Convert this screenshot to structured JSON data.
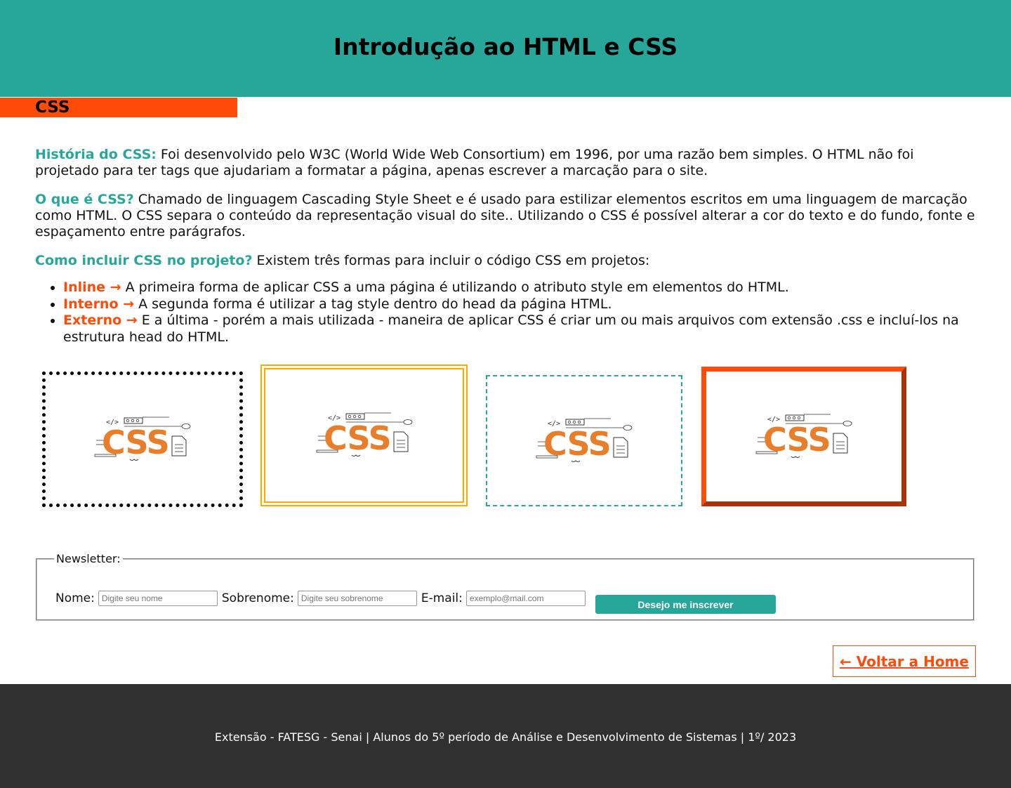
{
  "header": {
    "title": "Introdução ao HTML e CSS"
  },
  "section_tab": {
    "label": "CSS"
  },
  "content": {
    "historia": {
      "heading": "História do CSS:",
      "text": " Foi desenvolvido pelo W3C (World Wide Web Consortium) em 1996, por uma razão bem simples. O HTML não foi projetado para ter tags que ajudariam a formatar a página, apenas escrever a marcação para o site."
    },
    "oque": {
      "heading": "O que é CSS?",
      "text": " Chamado de linguagem Cascading Style Sheet e é usado para estilizar elementos escritos em uma linguagem de marcação como HTML. O CSS separa o conteúdo da representação visual do site.. Utilizando o CSS é possível alterar a cor do texto e do fundo, fonte e espaçamento entre parágrafos."
    },
    "como": {
      "heading": "Como incluir CSS no projeto?",
      "text": " Existem três formas para incluir o código CSS em projetos:"
    },
    "list": [
      {
        "label": "Inline →",
        "text": " A primeira forma de aplicar CSS a uma página é utilizando o atributo style em elementos do HTML."
      },
      {
        "label": "Interno →",
        "text": " A segunda forma é utilizar a tag style dentro do head da página HTML."
      },
      {
        "label": "Externo →",
        "text": " E a última - porém a mais utilizada - maneira de aplicar CSS é criar um ou mais arquivos com extensão .css e incluí-los na estrutura head do HTML."
      }
    ]
  },
  "logo": {
    "code_tag": "</>",
    "word": "CSS"
  },
  "colors": {
    "teal": "#27a69a",
    "orange": "#ff4b08",
    "logo_orange": "#e87d2a",
    "gold": "#ffa800",
    "footer_bg": "#303030"
  },
  "newsletter": {
    "legend": "Newsletter:",
    "nome_label": "Nome:",
    "nome_placeholder": "Digite seu nome",
    "sobrenome_label": "Sobrenome:",
    "sobrenome_placeholder": "Digite seu sobrenome",
    "email_label": "E-mail:",
    "email_placeholder": "exemplo@mail.com",
    "button_label": "Desejo me inscrever"
  },
  "back_link": {
    "label": "← Voltar a Home"
  },
  "footer": {
    "text": "Extensão - FATESG - Senai | Alunos do 5º período de Análise e Desenvolvimento de Sistemas | 1º/ 2023"
  }
}
